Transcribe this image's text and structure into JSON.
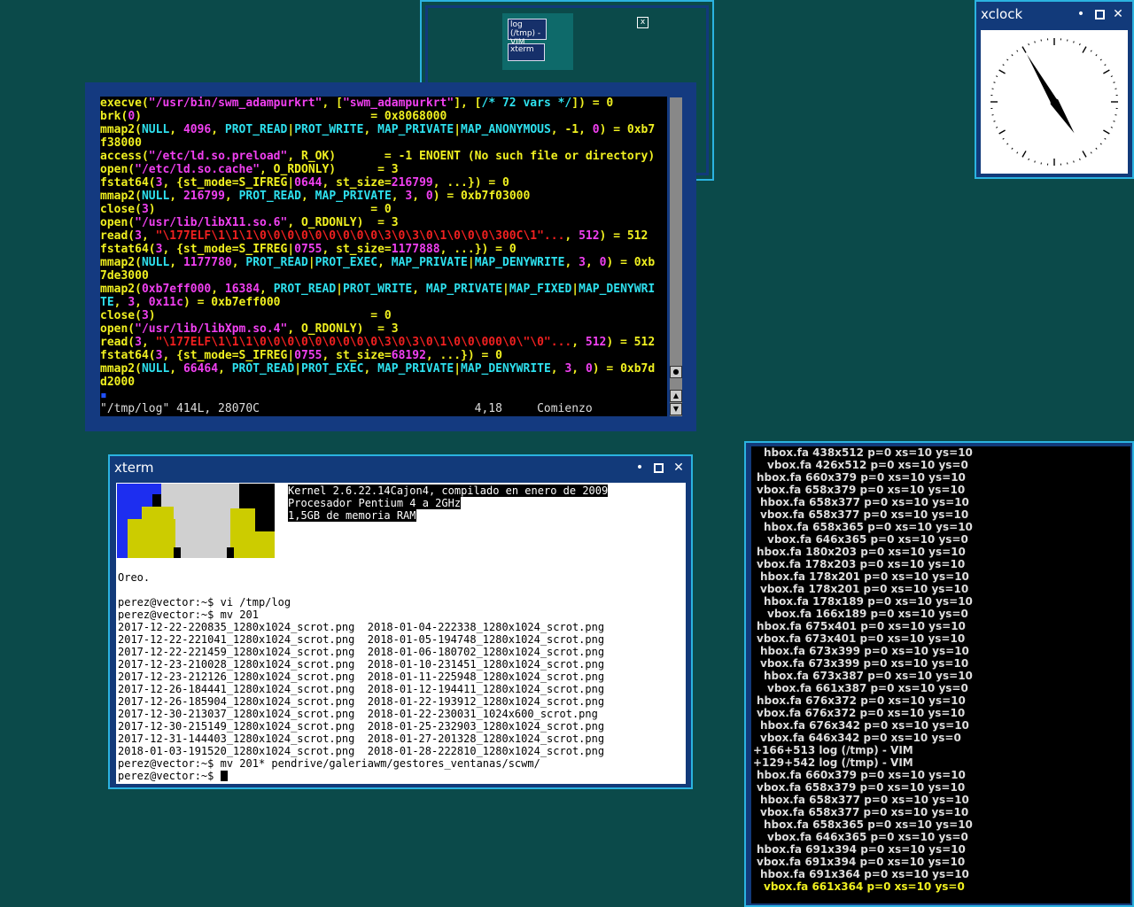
{
  "pager": {
    "windows": [
      {
        "label": "log (/tmp) - VIM"
      },
      {
        "label": "xterm"
      }
    ],
    "close_glyph": "x"
  },
  "vim": {
    "lines": [
      [
        [
          "y",
          "execve("
        ],
        [
          "m",
          "\"/usr/bin/swm_adampurkrt\""
        ],
        [
          "y",
          ", ["
        ],
        [
          "m",
          "\"swm_adampurkrt\""
        ],
        [
          "y",
          "], ["
        ],
        [
          "c",
          "/* 72 vars */"
        ],
        [
          "y",
          "]) = 0"
        ]
      ],
      [
        [
          "y",
          "brk("
        ],
        [
          "m",
          "0"
        ],
        [
          "y",
          ")                                 = 0x8068000"
        ]
      ],
      [
        [
          "y",
          "mmap2("
        ],
        [
          "c",
          "NULL"
        ],
        [
          "y",
          ", "
        ],
        [
          "m",
          "4096"
        ],
        [
          "y",
          ", "
        ],
        [
          "c",
          "PROT_READ"
        ],
        [
          "y",
          "|"
        ],
        [
          "c",
          "PROT_WRITE"
        ],
        [
          "y",
          ", "
        ],
        [
          "c",
          "MAP_PRIVATE"
        ],
        [
          "y",
          "|"
        ],
        [
          "c",
          "MAP_ANONYMOUS"
        ],
        [
          "y",
          ", -1, "
        ],
        [
          "m",
          "0"
        ],
        [
          "y",
          ") = 0xb7"
        ]
      ],
      [
        [
          "y",
          "f38000"
        ]
      ],
      [
        [
          "y",
          "access("
        ],
        [
          "m",
          "\"/etc/ld.so.preload\""
        ],
        [
          "y",
          ", R_OK)       = -1 ENOENT (No such file or directory)"
        ]
      ],
      [
        [
          "y",
          "open("
        ],
        [
          "m",
          "\"/etc/ld.so.cache\""
        ],
        [
          "y",
          ", O_RDONLY)      = 3"
        ]
      ],
      [
        [
          "y",
          "fstat64("
        ],
        [
          "m",
          "3"
        ],
        [
          "y",
          ", {st_mode=S_IFREG|"
        ],
        [
          "m",
          "0644"
        ],
        [
          "y",
          ", st_size="
        ],
        [
          "m",
          "216799"
        ],
        [
          "y",
          ", ...}) = 0"
        ]
      ],
      [
        [
          "y",
          "mmap2("
        ],
        [
          "c",
          "NULL"
        ],
        [
          "y",
          ", "
        ],
        [
          "m",
          "216799"
        ],
        [
          "y",
          ", "
        ],
        [
          "c",
          "PROT_READ"
        ],
        [
          "y",
          ", "
        ],
        [
          "c",
          "MAP_PRIVATE"
        ],
        [
          "y",
          ", "
        ],
        [
          "m",
          "3"
        ],
        [
          "y",
          ", "
        ],
        [
          "m",
          "0"
        ],
        [
          "y",
          ") = 0xb7f03000"
        ]
      ],
      [
        [
          "y",
          "close("
        ],
        [
          "m",
          "3"
        ],
        [
          "y",
          ")                               = 0"
        ]
      ],
      [
        [
          "y",
          "open("
        ],
        [
          "m",
          "\"/usr/lib/libX11.so.6\""
        ],
        [
          "y",
          ", O_RDONLY)  = 3"
        ]
      ],
      [
        [
          "y",
          "read("
        ],
        [
          "m",
          "3"
        ],
        [
          "y",
          ", "
        ],
        [
          "r",
          "\"\\177ELF\\1\\1\\1\\0\\0\\0\\0\\0\\0\\0\\0\\0\\3\\0\\3\\0\\1\\0\\0\\0\\300C\\1\"..."
        ],
        [
          "y",
          ", "
        ],
        [
          "m",
          "512"
        ],
        [
          "y",
          ") = 512"
        ]
      ],
      [
        [
          "y",
          "fstat64("
        ],
        [
          "m",
          "3"
        ],
        [
          "y",
          ", {st_mode=S_IFREG|"
        ],
        [
          "m",
          "0755"
        ],
        [
          "y",
          ", st_size="
        ],
        [
          "m",
          "1177888"
        ],
        [
          "y",
          ", ...}) = 0"
        ]
      ],
      [
        [
          "y",
          "mmap2("
        ],
        [
          "c",
          "NULL"
        ],
        [
          "y",
          ", "
        ],
        [
          "m",
          "1177780"
        ],
        [
          "y",
          ", "
        ],
        [
          "c",
          "PROT_READ"
        ],
        [
          "y",
          "|"
        ],
        [
          "c",
          "PROT_EXEC"
        ],
        [
          "y",
          ", "
        ],
        [
          "c",
          "MAP_PRIVATE"
        ],
        [
          "y",
          "|"
        ],
        [
          "c",
          "MAP_DENYWRITE"
        ],
        [
          "y",
          ", "
        ],
        [
          "m",
          "3"
        ],
        [
          "y",
          ", "
        ],
        [
          "m",
          "0"
        ],
        [
          "y",
          ") = 0xb"
        ]
      ],
      [
        [
          "y",
          "7de3000"
        ]
      ],
      [
        [
          "y",
          "mmap2("
        ],
        [
          "m",
          "0xb7eff000"
        ],
        [
          "y",
          ", "
        ],
        [
          "m",
          "16384"
        ],
        [
          "y",
          ", "
        ],
        [
          "c",
          "PROT_READ"
        ],
        [
          "y",
          "|"
        ],
        [
          "c",
          "PROT_WRITE"
        ],
        [
          "y",
          ", "
        ],
        [
          "c",
          "MAP_PRIVATE"
        ],
        [
          "y",
          "|"
        ],
        [
          "c",
          "MAP_FIXED"
        ],
        [
          "y",
          "|"
        ],
        [
          "c",
          "MAP_DENYWRI"
        ]
      ],
      [
        [
          "c",
          "TE"
        ],
        [
          "y",
          ", "
        ],
        [
          "m",
          "3"
        ],
        [
          "y",
          ", "
        ],
        [
          "m",
          "0x11c"
        ],
        [
          "y",
          ") = 0xb7eff000"
        ]
      ],
      [
        [
          "y",
          "close("
        ],
        [
          "m",
          "3"
        ],
        [
          "y",
          ")                               = 0"
        ]
      ],
      [
        [
          "y",
          "open("
        ],
        [
          "m",
          "\"/usr/lib/libXpm.so.4\""
        ],
        [
          "y",
          ", O_RDONLY)  = 3"
        ]
      ],
      [
        [
          "y",
          "read("
        ],
        [
          "m",
          "3"
        ],
        [
          "y",
          ", "
        ],
        [
          "r",
          "\"\\177ELF\\1\\1\\1\\0\\0\\0\\0\\0\\0\\0\\0\\0\\3\\0\\3\\0\\1\\0\\0\\000\\0\\\"\\0\"..."
        ],
        [
          "y",
          ", "
        ],
        [
          "m",
          "512"
        ],
        [
          "y",
          ") = 512"
        ]
      ],
      [
        [
          "y",
          "fstat64("
        ],
        [
          "m",
          "3"
        ],
        [
          "y",
          ", {st_mode=S_IFREG|"
        ],
        [
          "m",
          "0755"
        ],
        [
          "y",
          ", st_size="
        ],
        [
          "m",
          "68192"
        ],
        [
          "y",
          ", ...}) = 0"
        ]
      ],
      [
        [
          "y",
          "mmap2("
        ],
        [
          "c",
          "NULL"
        ],
        [
          "y",
          ", "
        ],
        [
          "m",
          "66464"
        ],
        [
          "y",
          ", "
        ],
        [
          "c",
          "PROT_READ"
        ],
        [
          "y",
          "|"
        ],
        [
          "c",
          "PROT_EXEC"
        ],
        [
          "y",
          ", "
        ],
        [
          "c",
          "MAP_PRIVATE"
        ],
        [
          "y",
          "|"
        ],
        [
          "c",
          "MAP_DENYWRITE"
        ],
        [
          "y",
          ", "
        ],
        [
          "m",
          "3"
        ],
        [
          "y",
          ", "
        ],
        [
          "m",
          "0"
        ],
        [
          "y",
          ") = 0xb7d"
        ]
      ],
      [
        [
          "y",
          "d2000"
        ]
      ],
      [
        [
          "b",
          "▪"
        ]
      ]
    ],
    "status": "\"/tmp/log\" 414L, 28070C                               4,18     Comienzo"
  },
  "xclock": {
    "title": "xclock",
    "time": {
      "hour": 4,
      "minute": 55
    }
  },
  "xterm": {
    "title": "xterm",
    "sysinfo": [
      "Kernel 2.6.22.14Cajon4, compilado en enero de 2009",
      "Procesador Pentium 4 a 2GHz",
      "1,5GB de memoria RAM"
    ],
    "lines": [
      "Oreo.",
      "",
      "perez@vector:~$ vi /tmp/log",
      "perez@vector:~$ mv 201",
      "2017-12-22-220835_1280x1024_scrot.png  2018-01-04-222338_1280x1024_scrot.png",
      "2017-12-22-221041_1280x1024_scrot.png  2018-01-05-194748_1280x1024_scrot.png",
      "2017-12-22-221459_1280x1024_scrot.png  2018-01-06-180702_1280x1024_scrot.png",
      "2017-12-23-210028_1280x1024_scrot.png  2018-01-10-231451_1280x1024_scrot.png",
      "2017-12-23-212126_1280x1024_scrot.png  2018-01-11-225948_1280x1024_scrot.png",
      "2017-12-26-184441_1280x1024_scrot.png  2018-01-12-194411_1280x1024_scrot.png",
      "2017-12-26-185904_1280x1024_scrot.png  2018-01-22-193912_1280x1024_scrot.png",
      "2017-12-30-213037_1280x1024_scrot.png  2018-01-22-230031_1024x600_scrot.png",
      "2017-12-30-215149_1280x1024_scrot.png  2018-01-25-232903_1280x1024_scrot.png",
      "2017-12-31-144403_1280x1024_scrot.png  2018-01-27-201328_1280x1024_scrot.png",
      "2018-01-03-191520_1280x1024_scrot.png  2018-01-28-222810_1280x1024_scrot.png",
      "perez@vector:~$ mv 201* pendrive/galeriawm/gestores_ventanas/scwm/",
      "perez@vector:~$ "
    ]
  },
  "log": {
    "lines": [
      {
        "indent": 3,
        "text": "hbox.fa 438x512 p=0 xs=10 ys=10"
      },
      {
        "indent": 4,
        "text": "vbox.fa 426x512 p=0 xs=10 ys=0"
      },
      {
        "indent": 1,
        "text": "hbox.fa 660x379 p=0 xs=10 ys=10"
      },
      {
        "indent": 1,
        "text": "vbox.fa 658x379 p=0 xs=10 ys=10"
      },
      {
        "indent": 2,
        "text": "hbox.fa 658x377 p=0 xs=10 ys=10"
      },
      {
        "indent": 2,
        "text": "vbox.fa 658x377 p=0 xs=10 ys=10"
      },
      {
        "indent": 3,
        "text": "hbox.fa 658x365 p=0 xs=10 ys=10"
      },
      {
        "indent": 4,
        "text": "vbox.fa 646x365 p=0 xs=10 ys=0"
      },
      {
        "indent": 1,
        "text": "hbox.fa 180x203 p=0 xs=10 ys=10"
      },
      {
        "indent": 1,
        "text": "vbox.fa 178x203 p=0 xs=10 ys=10"
      },
      {
        "indent": 2,
        "text": "hbox.fa 178x201 p=0 xs=10 ys=10"
      },
      {
        "indent": 2,
        "text": "vbox.fa 178x201 p=0 xs=10 ys=10"
      },
      {
        "indent": 3,
        "text": "hbox.fa 178x189 p=0 xs=10 ys=10"
      },
      {
        "indent": 4,
        "text": "vbox.fa 166x189 p=0 xs=10 ys=0"
      },
      {
        "indent": 1,
        "text": "hbox.fa 675x401 p=0 xs=10 ys=10"
      },
      {
        "indent": 1,
        "text": "vbox.fa 673x401 p=0 xs=10 ys=10"
      },
      {
        "indent": 2,
        "text": "hbox.fa 673x399 p=0 xs=10 ys=10"
      },
      {
        "indent": 2,
        "text": "vbox.fa 673x399 p=0 xs=10 ys=10"
      },
      {
        "indent": 3,
        "text": "hbox.fa 673x387 p=0 xs=10 ys=10"
      },
      {
        "indent": 4,
        "text": "vbox.fa 661x387 p=0 xs=10 ys=0"
      },
      {
        "indent": 1,
        "text": "hbox.fa 676x372 p=0 xs=10 ys=10"
      },
      {
        "indent": 1,
        "text": "vbox.fa 676x372 p=0 xs=10 ys=10"
      },
      {
        "indent": 2,
        "text": "hbox.fa 676x342 p=0 xs=10 ys=10"
      },
      {
        "indent": 2,
        "text": "vbox.fa 646x342 p=0 xs=10 ys=0"
      },
      {
        "indent": 0,
        "text": "+166+513 log (/tmp) - VIM"
      },
      {
        "indent": 0,
        "text": "+129+542 log (/tmp) - VIM"
      },
      {
        "indent": 1,
        "text": "hbox.fa 660x379 p=0 xs=10 ys=10"
      },
      {
        "indent": 1,
        "text": "vbox.fa 658x379 p=0 xs=10 ys=10"
      },
      {
        "indent": 2,
        "text": "hbox.fa 658x377 p=0 xs=10 ys=10"
      },
      {
        "indent": 2,
        "text": "vbox.fa 658x377 p=0 xs=10 ys=10"
      },
      {
        "indent": 3,
        "text": "hbox.fa 658x365 p=0 xs=10 ys=10"
      },
      {
        "indent": 4,
        "text": "vbox.fa 646x365 p=0 xs=10 ys=0"
      },
      {
        "indent": 1,
        "text": "hbox.fa 691x394 p=0 xs=10 ys=10"
      },
      {
        "indent": 1,
        "text": "vbox.fa 691x394 p=0 xs=10 ys=10"
      },
      {
        "indent": 2,
        "text": "hbox.fa 691x364 p=0 xs=10 ys=10"
      },
      {
        "indent": 3,
        "text": "vbox.fa 661x364 p=0 xs=10 ys=0",
        "highlight": true
      }
    ],
    "highlight_color": "#f0f020"
  },
  "colors": {
    "desktop": "#0b4a4a",
    "frame": "#123a7a",
    "border": "#2bb3e0"
  }
}
